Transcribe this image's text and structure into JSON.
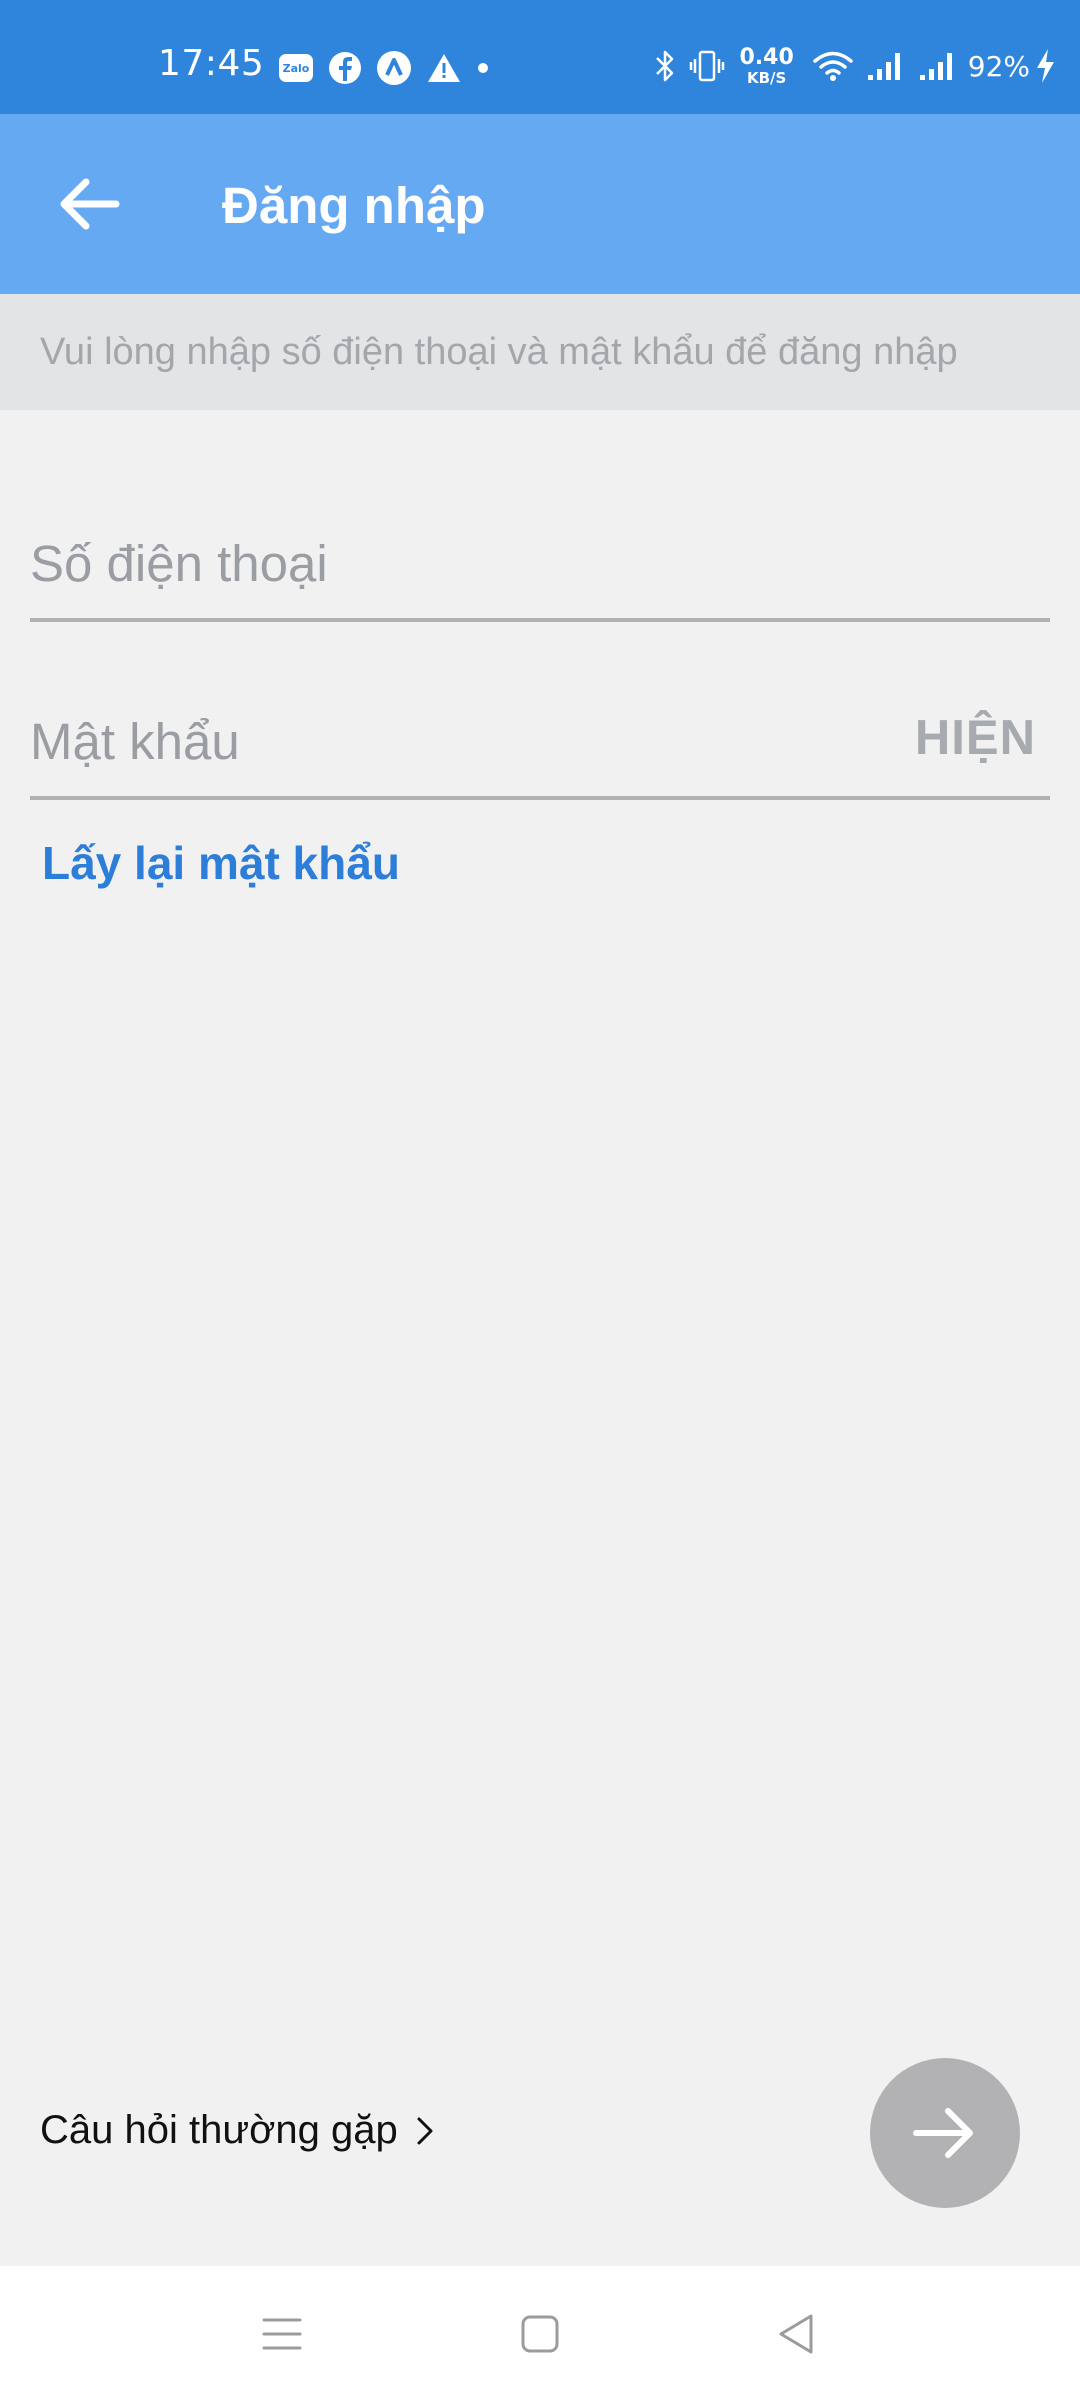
{
  "status_bar": {
    "time": "17:45",
    "left_icons": [
      "zalo-icon",
      "facebook-icon",
      "notification-icon",
      "warning-icon",
      "dot-icon"
    ],
    "net_speed_value": "0.40",
    "net_speed_unit": "KB/S",
    "battery_percent": "92%",
    "right_icons": [
      "bluetooth-icon",
      "vibrate-icon",
      "wifi-icon",
      "signal-icon",
      "signal-icon",
      "charging-icon"
    ],
    "zalo_badge": "Zalo"
  },
  "app_bar": {
    "title": "Đăng nhập",
    "back_icon": "arrow-left-icon"
  },
  "hint": {
    "text": "Vui lòng nhập số điện thoại và mật khẩu để đăng nhập"
  },
  "form": {
    "phone_placeholder": "Số điện thoại",
    "phone_value": "",
    "password_placeholder": "Mật khẩu",
    "password_value": "",
    "show_label": "HIỆN",
    "forgot_label": "Lấy lại mật khẩu"
  },
  "footer": {
    "faq_label": "Câu hỏi thường gặp",
    "faq_icon": "chevron-right-icon",
    "next_icon": "arrow-right-icon"
  },
  "nav_bar": {
    "icons": [
      "menu-icon",
      "home-icon",
      "back-triangle-icon"
    ]
  },
  "colors": {
    "status_bar": "#2f84dc",
    "app_bar": "#65a9f3",
    "hint_bar": "#e3e4e6",
    "background": "#f1f1f2",
    "link": "#2c7ed8",
    "next_button_disabled": "#b2b2b4"
  }
}
